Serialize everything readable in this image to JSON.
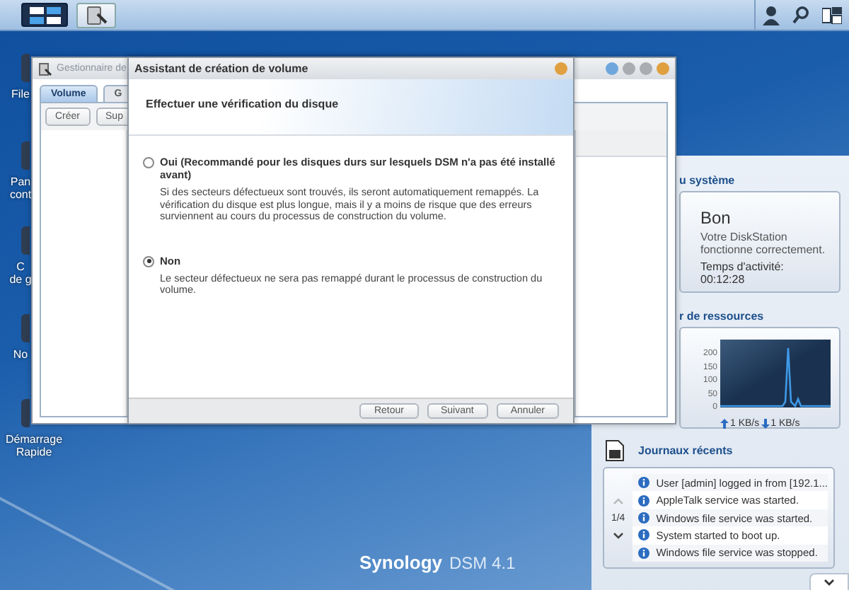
{
  "desktop_icons": [
    {
      "lines": [
        "File"
      ]
    },
    {
      "lines": [
        "Pan",
        "cont"
      ]
    },
    {
      "lines": [
        "C",
        "de g"
      ]
    },
    {
      "lines": [
        "No"
      ]
    },
    {
      "lines": [
        "Démarrage",
        "Rapide"
      ]
    }
  ],
  "storage_window": {
    "title": "Gestionnaire de",
    "tabs": [
      {
        "label": "Volume",
        "selected": true
      },
      {
        "label": "G",
        "selected": false
      }
    ],
    "toolbar": [
      "Créer",
      "Sup"
    ]
  },
  "wizard": {
    "title": "Assistant de création de volume",
    "heading": "Effectuer une vérification du disque",
    "options": [
      {
        "label": "Oui (Recommandé pour les disques durs sur lesquels DSM n'a pas été installé avant)",
        "description": "Si des secteurs défectueux sont trouvés, ils seront automatiquement remappés. La vérification du disque est plus longue, mais il y a moins de risque que des erreurs surviennent au cours du processus de construction du volume.",
        "selected": false
      },
      {
        "label": "Non",
        "description": "Le secteur défectueux ne sera pas remappé durant le processus de construction du volume.",
        "selected": true
      }
    ],
    "buttons": [
      "Retour",
      "Suivant",
      "Annuler"
    ]
  },
  "widgets": {
    "system_health": {
      "title": "u système",
      "status": "Bon",
      "message": "Votre DiskStation fonctionne correctement.",
      "uptime": "Temps d'activité: 00:12:28"
    },
    "resource_monitor": {
      "title": "r de ressources",
      "yticks": [
        "200",
        "150",
        "100",
        "50",
        "0"
      ],
      "upload": "1 KB/s",
      "download": "1 KB/s"
    },
    "recent_logs": {
      "title": "Journaux récents",
      "page": "1/4",
      "entries": [
        "User [admin] logged in from [192.1...",
        "AppleTalk service was started.",
        "Windows file service was started.",
        "System started to boot up.",
        "Windows file service was stopped."
      ]
    }
  },
  "brand": {
    "name": "Synology",
    "product": "DSM 4.1"
  }
}
